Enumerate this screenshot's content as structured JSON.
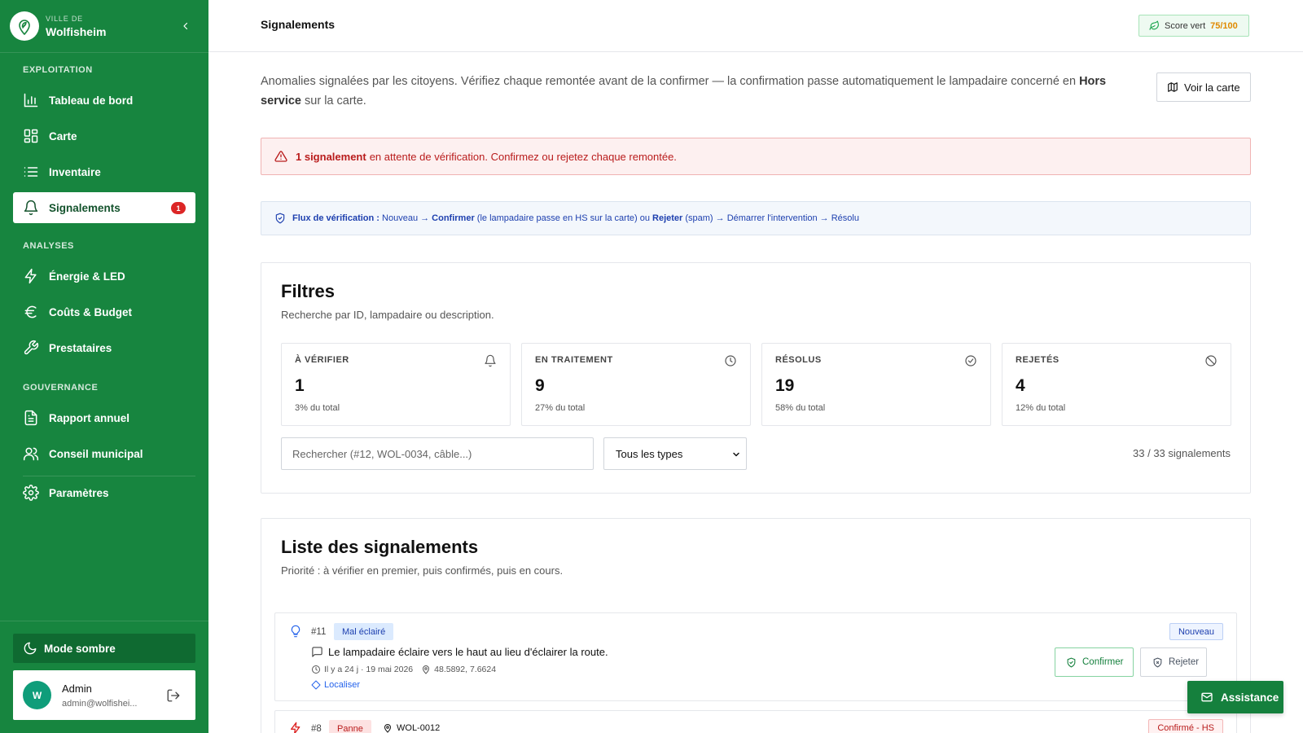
{
  "sidebar": {
    "brand": {
      "sub": "VILLE DE",
      "name": "Wolfisheim"
    },
    "sections": [
      "EXPLOITATION",
      "ANALYSES",
      "GOUVERNANCE"
    ],
    "items": [
      {
        "label": "Tableau de bord",
        "icon": "bar-chart-icon"
      },
      {
        "label": "Carte",
        "icon": "grid-icon"
      },
      {
        "label": "Inventaire",
        "icon": "list-icon"
      },
      {
        "label": "Signalements",
        "icon": "bell-icon",
        "badge": "1",
        "active": true
      },
      {
        "label": "Énergie & LED",
        "icon": "zap-icon"
      },
      {
        "label": "Coûts & Budget",
        "icon": "euro-icon"
      },
      {
        "label": "Prestataires",
        "icon": "wrench-icon"
      },
      {
        "label": "Rapport annuel",
        "icon": "file-icon"
      },
      {
        "label": "Conseil municipal",
        "icon": "users-icon"
      },
      {
        "label": "Paramètres",
        "icon": "gear-icon"
      }
    ],
    "dark_mode": "Mode sombre",
    "user": {
      "initial": "W",
      "name": "Admin",
      "email": "admin@wolfishei..."
    }
  },
  "header": {
    "title": "Signalements",
    "score_label": "Score vert",
    "score_value": "75/100"
  },
  "intro": {
    "text": "Anomalies signalées par les citoyens. Vérifiez chaque remontée avant de la confirmer — la confirmation passe automatiquement le lampadaire concerné en",
    "bold": "Hors service",
    "end": "sur la carte.",
    "map_button": "Voir la carte"
  },
  "alert": {
    "bold": "1 signalement",
    "text": "en attente de vérification. Confirmez ou rejetez chaque remontée."
  },
  "flow": {
    "label": "Flux de vérification :",
    "t1": " Nouveau → ",
    "b1": "Confirmer",
    "t2": " (le lampadaire passe en HS sur la carte) ou ",
    "b2": "Rejeter",
    "t3": " (spam) → Démarrer l'intervention → Résolu"
  },
  "filters": {
    "title": "Filtres",
    "subtitle": "Recherche par ID, lampadaire ou description.",
    "stats": [
      {
        "label": "À VÉRIFIER",
        "value": "1",
        "pct": "3% du total",
        "icon": "bell-icon"
      },
      {
        "label": "EN TRAITEMENT",
        "value": "9",
        "pct": "27% du total",
        "icon": "clock-icon"
      },
      {
        "label": "RÉSOLUS",
        "value": "19",
        "pct": "58% du total",
        "icon": "check-circle-icon"
      },
      {
        "label": "REJETÉS",
        "value": "4",
        "pct": "12% du total",
        "icon": "ban-icon"
      }
    ],
    "search_placeholder": "Rechercher (#12, WOL-0034, câble...)",
    "type_select": "Tous les types",
    "count": "33 / 33 signalements"
  },
  "list": {
    "title": "Liste des signalements",
    "subtitle": "Priorité : à vérifier en premier, puis confirmés, puis en cours.",
    "reports": [
      {
        "id": "#11",
        "type": "Mal éclairé",
        "status": "Nouveau",
        "description": "Le lampadaire éclaire vers le haut au lieu d'éclairer la route.",
        "time": "Il y a 24 j · 19 mai 2026",
        "coords": "48.5892, 7.6624",
        "locate": "Localiser",
        "confirm": "Confirmer",
        "reject": "Rejeter"
      },
      {
        "id": "#8",
        "type": "Panne",
        "lamp": "WOL-0012",
        "status": "Confirmé - HS"
      }
    ]
  },
  "assist": "Assistance"
}
